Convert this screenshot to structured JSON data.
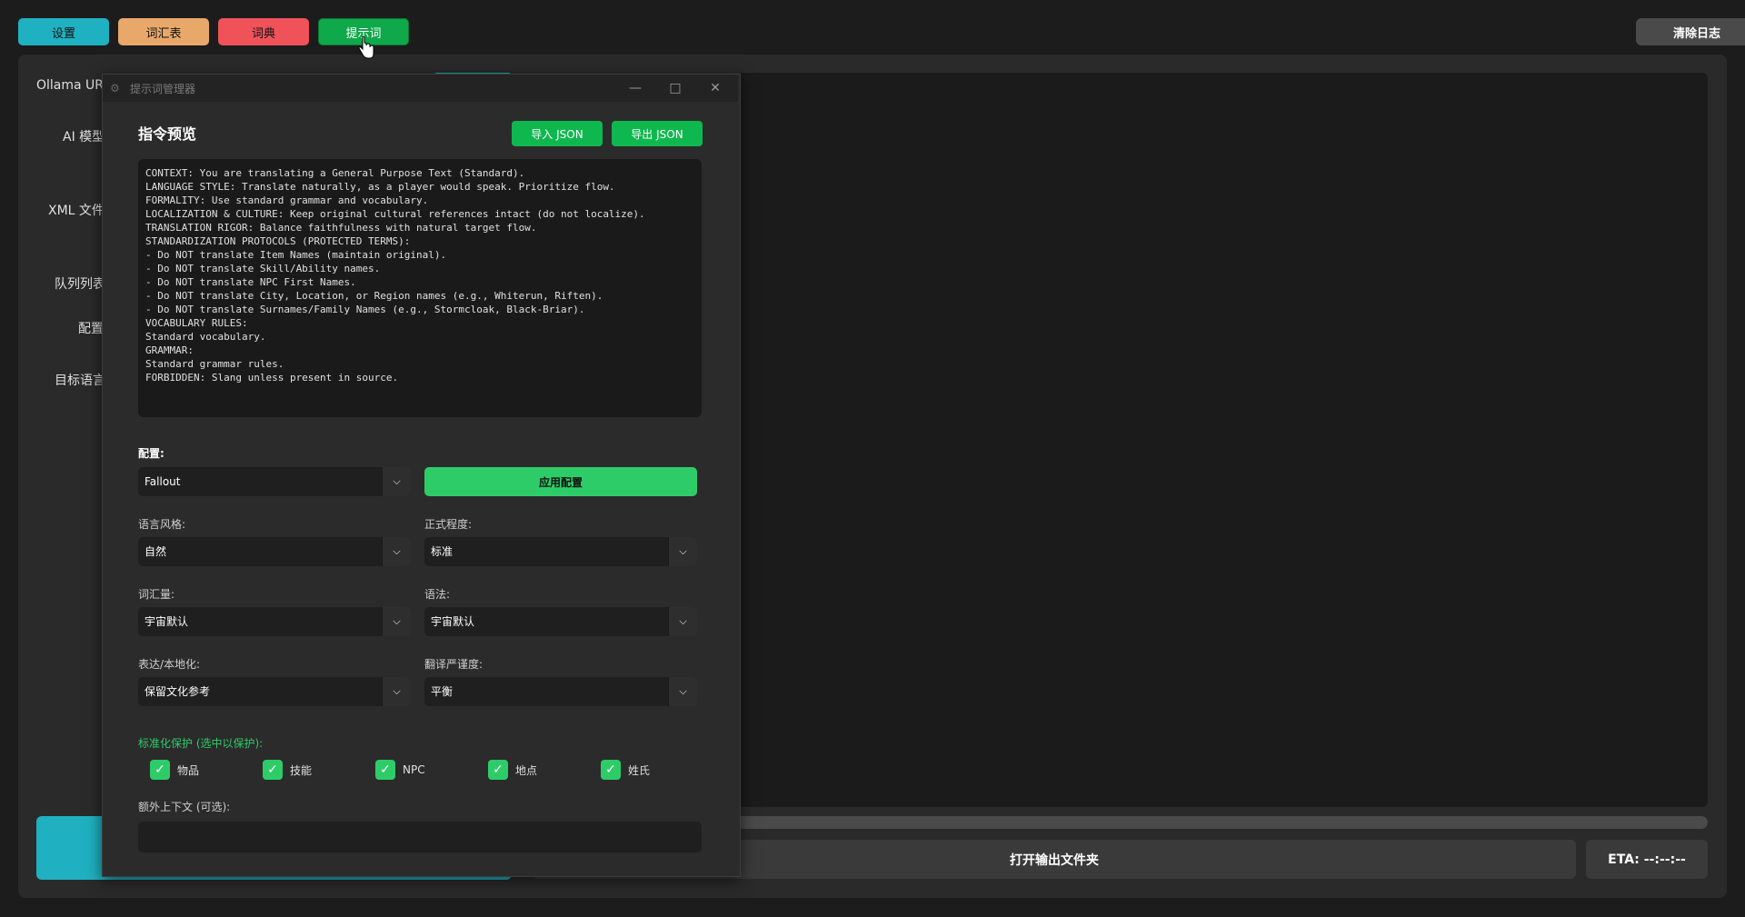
{
  "toolbar": {
    "settings": "设置",
    "glossary": "词汇表",
    "dictionary": "词典",
    "prompts": "提示词",
    "clear_log": "清除日志"
  },
  "left_labels": [
    "Ollama URL",
    "AI 模型",
    "XML 文件",
    "队列列表",
    "配置",
    "目标语言"
  ],
  "bottom": {
    "open_folder": "打开输出文件夹",
    "eta": "ETA: --:--:--"
  },
  "dialog": {
    "title": "提示词管理器",
    "heading": "指令预览",
    "import_json": "导入 JSON",
    "export_json": "导出 JSON",
    "preview_text": "CONTEXT: You are translating a General Purpose Text (Standard).\nLANGUAGE STYLE: Translate naturally, as a player would speak. Prioritize flow.\nFORMALITY: Use standard grammar and vocabulary.\nLOCALIZATION & CULTURE: Keep original cultural references intact (do not localize).\nTRANSLATION RIGOR: Balance faithfulness with natural target flow.\nSTANDARDIZATION PROTOCOLS (PROTECTED TERMS):\n- Do NOT translate Item Names (maintain original).\n- Do NOT translate Skill/Ability names.\n- Do NOT translate NPC First Names.\n- Do NOT translate City, Location, or Region names (e.g., Whiterun, Riften).\n- Do NOT translate Surnames/Family Names (e.g., Stormcloak, Black-Briar).\nVOCABULARY RULES:\nStandard vocabulary.\nGRAMMAR:\nStandard grammar rules.\nFORBIDDEN: Slang unless present in source.",
    "profile_label": "配置:",
    "profile_value": "Fallout",
    "apply_profile": "应用配置",
    "style_label": "语言风格:",
    "style_value": "自然",
    "formality_label": "正式程度:",
    "formality_value": "标准",
    "vocab_label": "词汇量:",
    "vocab_value": "宇宙默认",
    "grammar_label": "语法:",
    "grammar_value": "宇宙默认",
    "localization_label": "表达/本地化:",
    "localization_value": "保留文化参考",
    "rigor_label": "翻译严谨度:",
    "rigor_value": "平衡",
    "protection_label": "标准化保护 (选中以保护):",
    "checkboxes": [
      "物品",
      "技能",
      "NPC",
      "地点",
      "姓氏"
    ],
    "extra_context_label": "额外上下文 (可选):"
  },
  "colors": {
    "settings": "#1fb1c1",
    "glossary": "#e8a86a",
    "dictionary": "#f0525a",
    "prompts": "#0fa84a",
    "accent_green": "#2ecc68"
  }
}
